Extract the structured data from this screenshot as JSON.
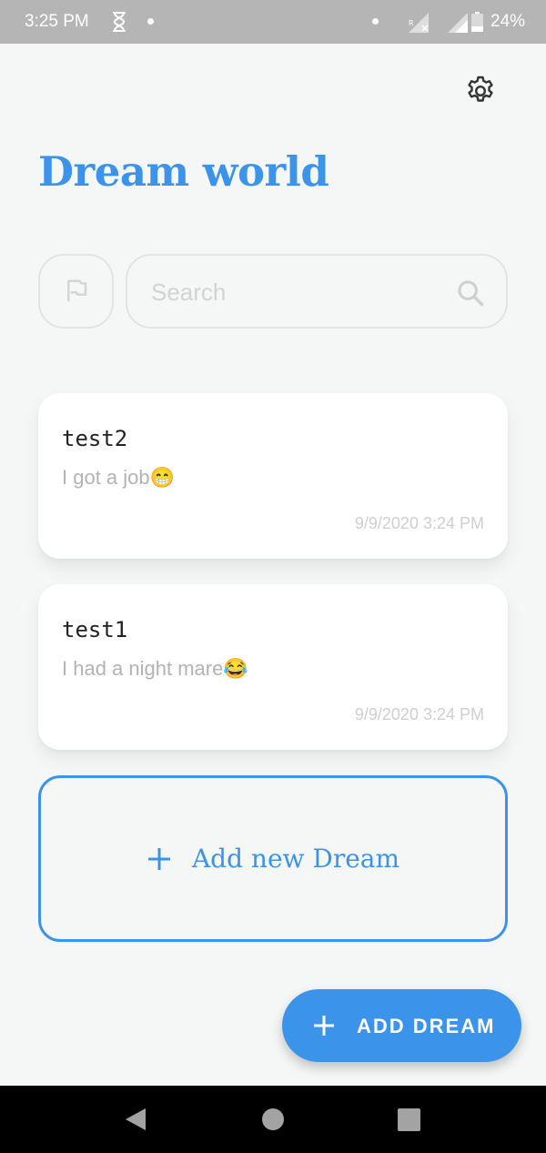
{
  "status_bar": {
    "time": "3:25 PM",
    "battery_percent": "24%",
    "icons": [
      "hourglass-icon",
      "dot-icon",
      "dot-icon",
      "signal-roaming-icon",
      "signal-icon",
      "battery-icon"
    ]
  },
  "header": {
    "title": "Dream world",
    "settings_icon": "gear-icon"
  },
  "search": {
    "placeholder": "Search",
    "value": "",
    "filter_icon": "flag-icon",
    "search_icon": "search-icon"
  },
  "dreams": [
    {
      "title": "test2",
      "body": "I got a job😁",
      "date": "9/9/2020 3:24 PM"
    },
    {
      "title": "test1",
      "body": "I had a night mare😂",
      "date": "9/9/2020 3:24 PM"
    }
  ],
  "add_new": {
    "label": "Add new Dream",
    "icon": "plus-icon"
  },
  "fab": {
    "label": "ADD DREAM",
    "icon": "plus-icon"
  },
  "nav_bar": {
    "icons": [
      "back-icon",
      "home-icon",
      "recents-icon"
    ]
  },
  "colors": {
    "accent": "#3b93ea",
    "background": "#f5f6f6",
    "card": "#ffffff",
    "status_bar": "#b5b5b5",
    "nav_bar": "#000000"
  }
}
